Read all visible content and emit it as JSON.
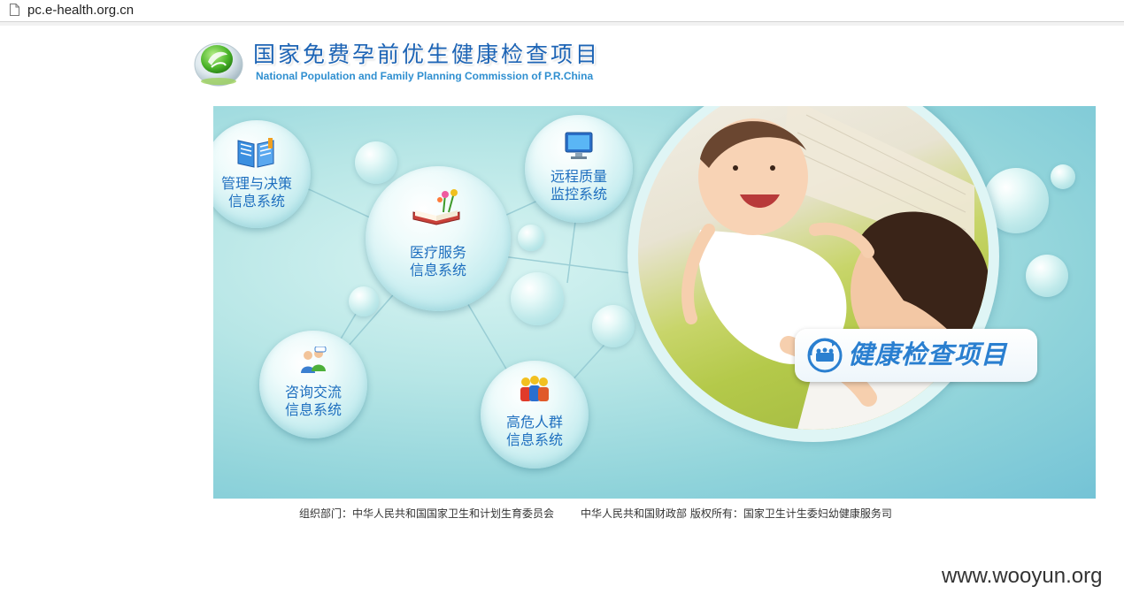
{
  "browser": {
    "url": "pc.e-health.org.cn"
  },
  "header": {
    "title": "国家免费孕前优生健康检查项目",
    "subtitle": "National Population and Family Planning Commission of P.R.China",
    "logo_icon": "leaf-logo-icon"
  },
  "banner": {
    "nodes": [
      {
        "line1": "管理与决策",
        "line2": "信息系统",
        "icon": "open-book-icon"
      },
      {
        "line1": "医疗服务",
        "line2": "信息系统",
        "icon": "book-with-flowers-icon"
      },
      {
        "line1": "远程质量",
        "line2": "监控系统",
        "icon": "monitor-icon"
      },
      {
        "line1": "咨询交流",
        "line2": "信息系统",
        "icon": "people-chat-icon"
      },
      {
        "line1": "高危人群",
        "line2": "信息系统",
        "icon": "group-people-icon"
      }
    ],
    "badge_label": "健康检查项目",
    "badge_icon": "family-circle-icon"
  },
  "footer": {
    "organizer": "组织部门：中华人民共和国国家卫生和计划生育委员会",
    "copyright": "中华人民共和国财政部 版权所有：国家卫生计生委妇幼健康服务司"
  },
  "watermark": "www.wooyun.org",
  "colors": {
    "title_blue": "#1d64b5",
    "node_text_blue": "#1e6fbf",
    "banner_teal": "#8fd3da"
  }
}
